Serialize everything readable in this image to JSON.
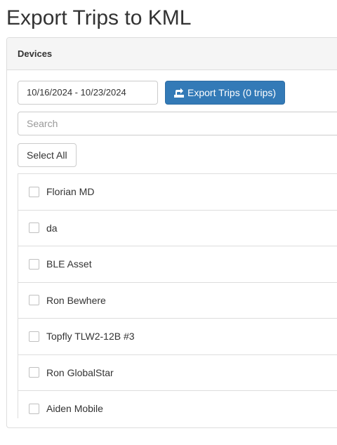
{
  "page": {
    "title": "Export Trips to KML"
  },
  "panel": {
    "heading": "Devices"
  },
  "toolbar": {
    "date_range": "10/16/2024 - 10/23/2024",
    "export_label": "Export Trips (0 trips)",
    "export_icon": "export-icon",
    "accent_color": "#337ab7"
  },
  "search": {
    "placeholder": "Search",
    "value": ""
  },
  "select_all_label": "Select All",
  "devices": [
    {
      "name": "Florian MD",
      "checked": false
    },
    {
      "name": "da",
      "checked": false
    },
    {
      "name": "BLE Asset",
      "checked": false
    },
    {
      "name": "Ron Bewhere",
      "checked": false
    },
    {
      "name": "Topfly TLW2-12B #3",
      "checked": false
    },
    {
      "name": "Ron GlobalStar",
      "checked": false
    },
    {
      "name": "Aiden Mobile",
      "checked": false
    }
  ]
}
